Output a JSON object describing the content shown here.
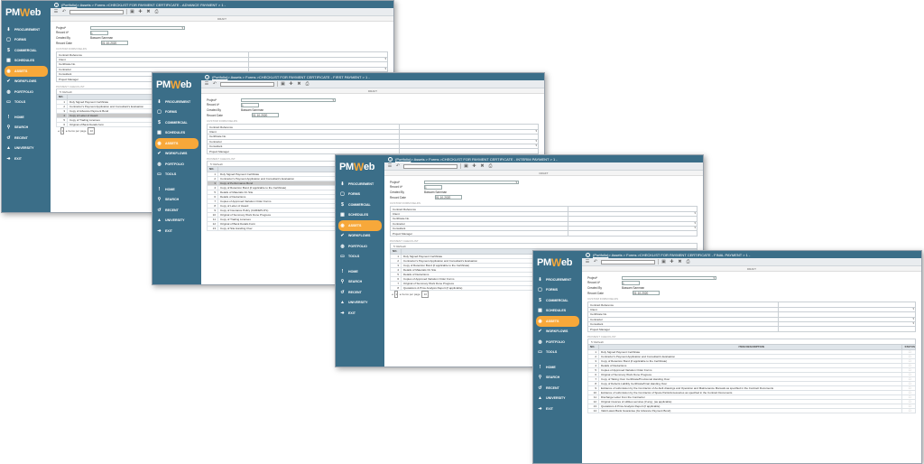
{
  "brand": {
    "logo_main": "PM",
    "logo_w": "W",
    "logo_end": "eb"
  },
  "nav": [
    {
      "label": "PROCUREMENT",
      "icon": "procurement-icon",
      "glyph": "⬇"
    },
    {
      "label": "FORMS",
      "icon": "forms-icon",
      "glyph": "▢"
    },
    {
      "label": "COMMERCIAL",
      "icon": "commercial-icon",
      "glyph": "$"
    },
    {
      "label": "SCHEDULES",
      "icon": "schedules-icon",
      "glyph": "▦"
    },
    {
      "label": "ASSETS",
      "icon": "assets-icon",
      "glyph": "◉"
    },
    {
      "label": "WORKFLOWS",
      "icon": "workflows-icon",
      "glyph": "✔"
    },
    {
      "label": "PORTFOLIO",
      "icon": "portfolio-icon",
      "glyph": "◍"
    },
    {
      "label": "TOOLS",
      "icon": "tools-icon",
      "glyph": "▭"
    }
  ],
  "nav2": [
    {
      "label": "HOME",
      "icon": "home-icon",
      "glyph": "!"
    },
    {
      "label": "SEARCH",
      "icon": "search-icon",
      "glyph": "⚲"
    },
    {
      "label": "RECENT",
      "icon": "recent-icon",
      "glyph": "↺"
    },
    {
      "label": "UNIVERSITY",
      "icon": "university-icon",
      "glyph": "▲"
    },
    {
      "label": "EXIT",
      "icon": "exit-icon",
      "glyph": "➜"
    }
  ],
  "crumb": {
    "root": "(Portfolio)",
    "path": " > Assets > Forms > "
  },
  "windows": [
    {
      "title": "CHECKLIST FOR PAYMENT CERTIFICATE - ADVANCE PAYMENT > 1 -"
    },
    {
      "title": "CHECKLIST FOR PAYMENT CERTIFICATE - FIRST PAYMENT > 1 -"
    },
    {
      "title": "CHECKLIST FOR PAYMENT CERTIFICATE - INTERIM PAYMENT > 1 -"
    },
    {
      "title": "CHECKLIST FOR PAYMENT CERTIFICATE - FINAL PAYMENT > 1 -"
    }
  ],
  "status": "DRAFT",
  "form": {
    "project_label": "Project*",
    "record_label": "Record #*",
    "record_value": "1",
    "created_label": "Created By",
    "created_value": "Bassam Samman",
    "date_label": "Record Date",
    "date_value": "01-10-2020"
  },
  "custom_title": "CUSTOM FORM FIELDS",
  "custom_fields": [
    "Contract Reference",
    "Client",
    "Certificate No.",
    "Contractor",
    "Consultant",
    "Project Manager"
  ],
  "checklist_title": "PAYMENT CHECKLIST",
  "refresh": "Refresh",
  "col_no": "NO.",
  "col_desc": "ITEM DESCRIPTION",
  "col_status": "STATUS",
  "lists": {
    "advance": [
      "Duly Signed Payment Certificate",
      "Contractor's Payment Application and Consultant's Evaluation",
      "Copy of Advance Payment Bond",
      "Copy of Letter of Award",
      "Copy of Trading Licenses",
      "Original of Bank Details form"
    ],
    "first": [
      "Duly Signed Payment Certificate",
      "Contractor's Payment Application and Consultant's Evaluation",
      "Copy of Performance Bond",
      "Copy of Retention Bond (if applicable to the Certificate)",
      "Details of Materials On Site",
      "Details of Deductions",
      "Copies of Approved Variation Order Forms",
      "Copy of Letter of Award",
      "Copy of Insurance Policy (CAR/EPL/PL)",
      "Original of Summary Work Done Progress",
      "Copy of Trading Licenses",
      "Original of Bank Details Form",
      "Copy of Site Handing Over"
    ],
    "interim": [
      "Duly Signed Payment Certificate",
      "Contractor's Payment Application and Consultant's Evaluation",
      "Copy of Retention Bond (if applicable to the Certificate)",
      "Details of Materials On Site",
      "Details of Deductions",
      "Copies of Approved Variation Order Forms",
      "Original of Summary Work Done Progress",
      "Quotations & Price Analysis Report (if applicable)"
    ],
    "final": [
      "Duly Signed Payment Certificate",
      "Contractor's Payment Application and Consultant's Evaluation",
      "Copy of Retention Bond (if applicable to the Certificate)",
      "Details of Deductions",
      "Copies of Approved Variation Order Forms",
      "Original of Summary Work Done Progress",
      "Copy of Taking Over Certificate/Provisional Handing Over",
      "Copy of Defects Liability Certificate/Final Handing Over",
      "Evidence of submission by the Contractor of As-built drawings and Operation and Maintenance Manuals as specified in the Contract Documents",
      "Evidence of submission by the Contractor of Spare Parts/Accessories as specified in the Contract Documents",
      "Discharge Letter from the Contractor",
      "Original invoices of utilities services (if any), (as applicable)",
      "Quotations & Price Analysis Report (if applicable)",
      "Valid Latest Bank Guarantee (for Advance Payment Bond)"
    ]
  },
  "pager": {
    "page": "1",
    "size_label": "Items per page",
    "size": "10"
  },
  "colors": {
    "sidebar": "#3b6e88",
    "accent": "#f7a83a"
  }
}
